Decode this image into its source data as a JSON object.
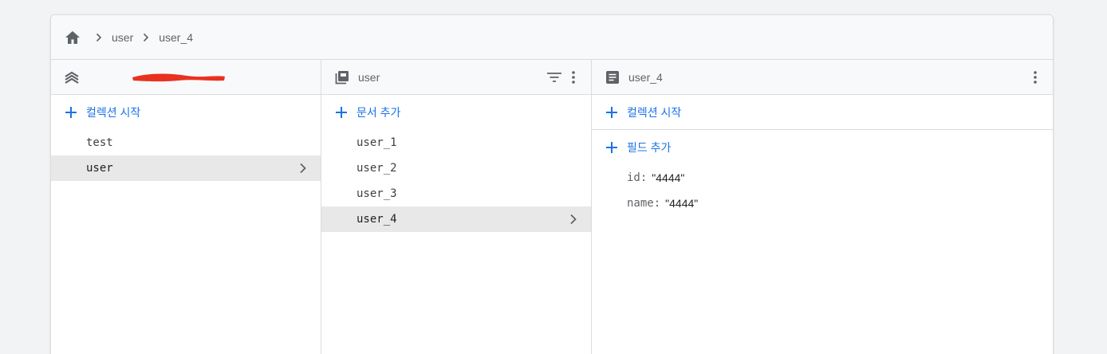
{
  "breadcrumb": {
    "items": [
      "user",
      "user_4"
    ]
  },
  "columns": [
    {
      "header": {
        "title": "",
        "icon": "firebase-project-icon"
      },
      "action": {
        "label": "컬렉션 시작",
        "icon": "plus-icon"
      },
      "items": [
        {
          "label": "test",
          "selected": false
        },
        {
          "label": "user",
          "selected": true
        }
      ]
    },
    {
      "header": {
        "title": "user",
        "icon": "collection-icon"
      },
      "action": {
        "label": "문서 추가",
        "icon": "plus-icon"
      },
      "items": [
        {
          "label": "user_1",
          "selected": false
        },
        {
          "label": "user_2",
          "selected": false
        },
        {
          "label": "user_3",
          "selected": false
        },
        {
          "label": "user_4",
          "selected": true
        }
      ]
    },
    {
      "header": {
        "title": "user_4",
        "icon": "document-icon"
      },
      "actions": [
        {
          "label": "컬렉션 시작",
          "icon": "plus-icon"
        },
        {
          "label": "필드 추가",
          "icon": "plus-icon"
        }
      ],
      "fields": [
        {
          "key": "id:",
          "value": "\"4444\""
        },
        {
          "key": "name:",
          "value": "\"4444\""
        }
      ]
    }
  ],
  "colors": {
    "accent": "#1a73e8",
    "selected_bg": "#e8e8e8",
    "redaction": "#e8321f"
  }
}
